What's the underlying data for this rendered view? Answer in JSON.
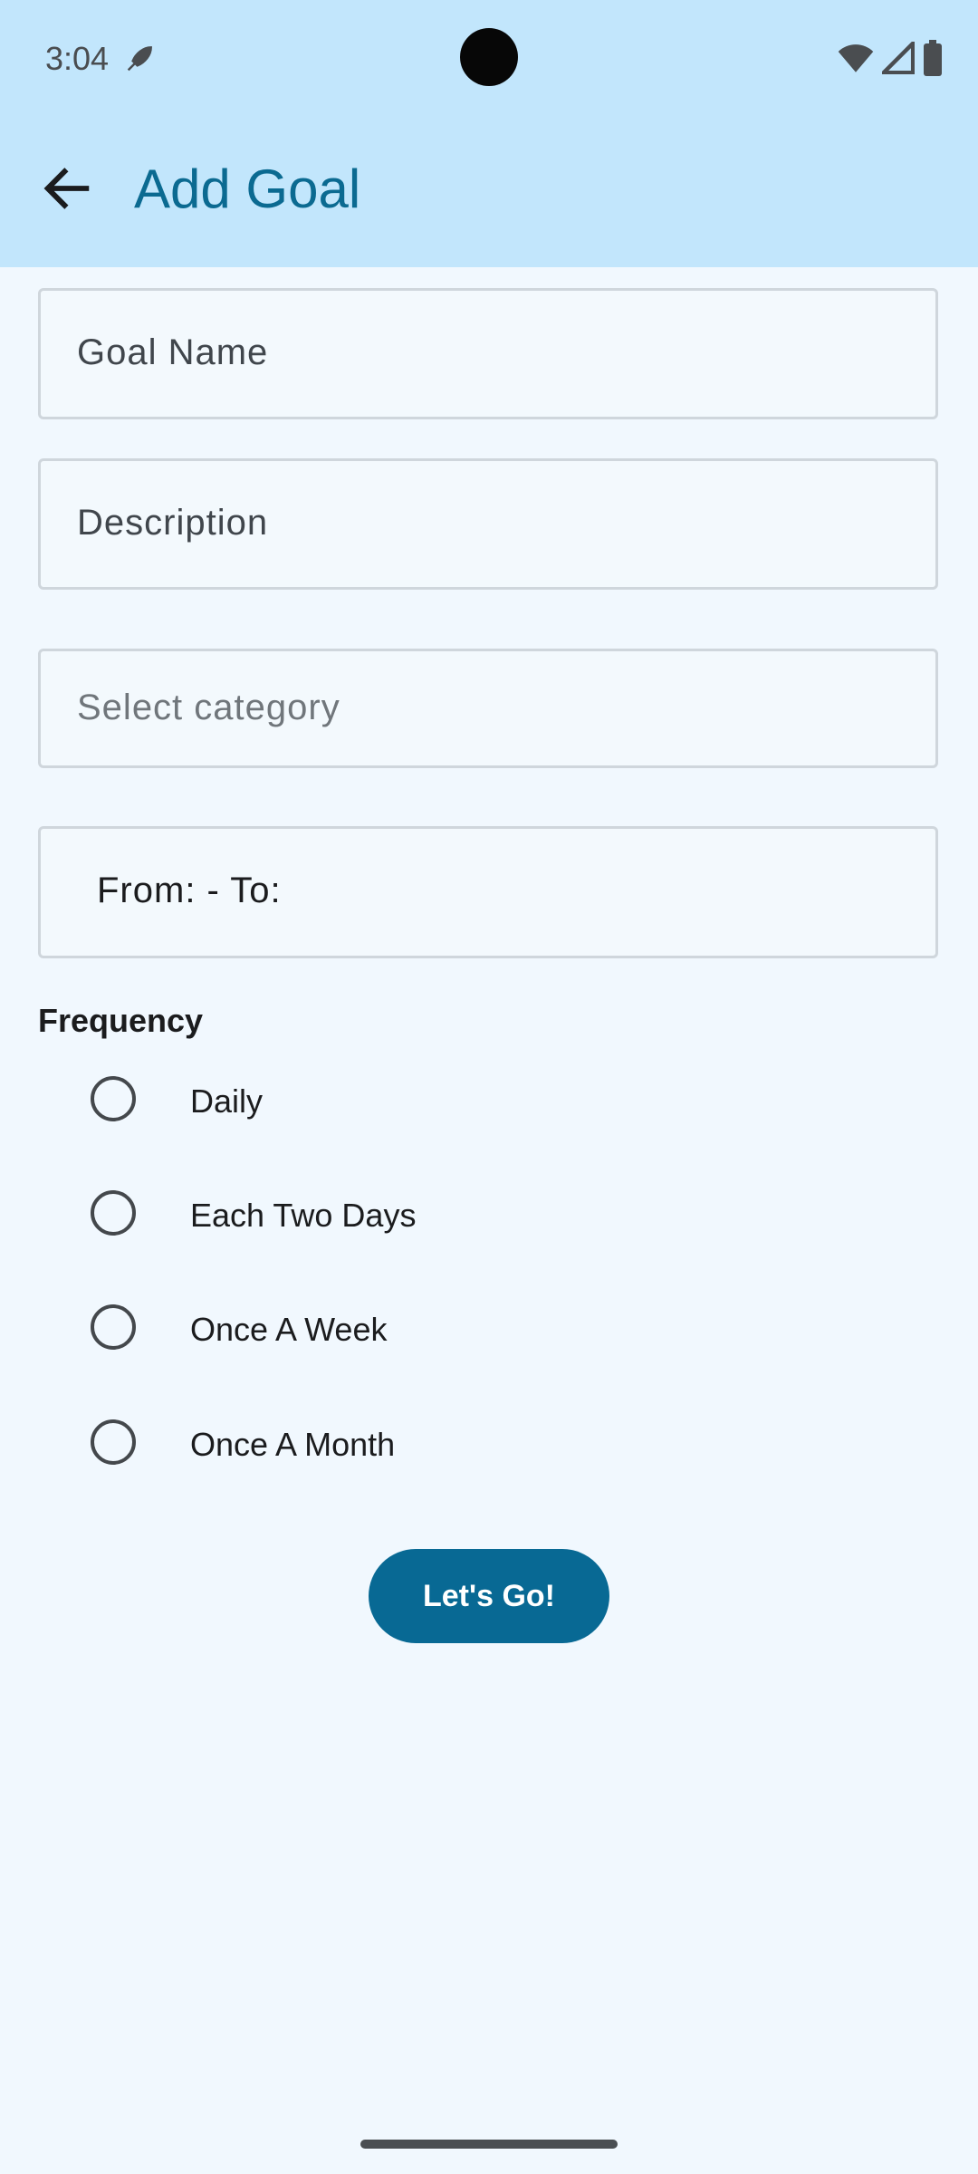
{
  "status_bar": {
    "time": "3:04",
    "notification_icon": "rocket-icon",
    "right_icons": [
      "wifi-icon",
      "signal-icon",
      "battery-icon"
    ]
  },
  "app_bar": {
    "back_icon": "arrow-back-icon",
    "title": "Add Goal"
  },
  "form": {
    "goal_name_placeholder": "Goal Name",
    "description_placeholder": "Description",
    "category_placeholder": "Select category",
    "date_range_text": "From:  - To:"
  },
  "frequency": {
    "label": "Frequency",
    "options": [
      "Daily",
      "Each Two Days",
      "Once A Week",
      "Once A Month"
    ],
    "selected": null
  },
  "submit_label": "Let's Go!",
  "colors": {
    "app_bar_bg": "#c2e6fc",
    "title": "#0b6a91",
    "button": "#086994",
    "page_bg": "#f1f8fe"
  }
}
